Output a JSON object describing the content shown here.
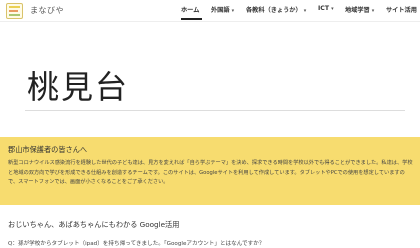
{
  "header": {
    "site_name": "まなびや",
    "logo_icon": "school-logo-icon",
    "nav": [
      {
        "label": "ホーム",
        "active": true,
        "has_menu": false
      },
      {
        "label": "外国語",
        "active": false,
        "has_menu": true
      },
      {
        "label": "各教科（きょうか）",
        "active": false,
        "has_menu": true
      },
      {
        "label": "ICT",
        "active": false,
        "has_menu": true
      },
      {
        "label": "地域学習",
        "active": false,
        "has_menu": true
      },
      {
        "label": "サイト活用",
        "active": false,
        "has_menu": false
      }
    ],
    "caret": "▾"
  },
  "hero": {
    "title": "桃見台"
  },
  "notice": {
    "title": "郡山市保護者の皆さんへ",
    "body": "新型コロナウイルス感染流行を経験した世代の子ども達は、見方を変えれば「自ら学ぶテーマ」を決め、探求できる時間を学校以外でも得ることができました。私達は、学校と地域の双方向で学びを形成できる仕組みを創造するチームです。このサイトは、Googleサイトを利用して作成しています。タブレットやPCでの使用を想定していますので、スマートフォンでは、画面が小さくなることをご了承ください。",
    "background": "#f7dc6f"
  },
  "section": {
    "heading": "おじいちゃん、あばあちゃんにもわかる Google活用",
    "qa": "Q：孫が学校からタブレット（ipad）を持ち帰ってきました。「Googleアカウント」とはなんですか？"
  }
}
